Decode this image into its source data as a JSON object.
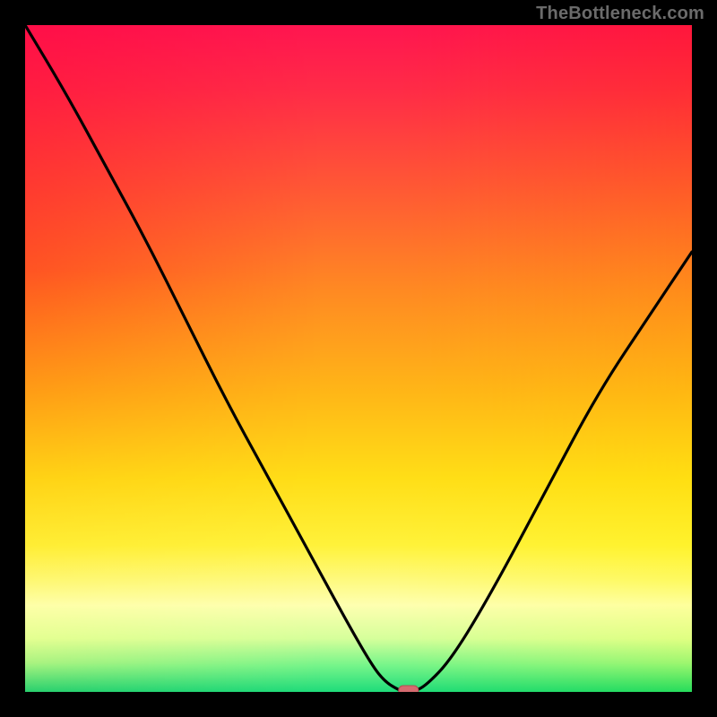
{
  "watermark": "TheBottleneck.com",
  "colors": {
    "background": "#000000",
    "curve": "#000000",
    "marker": "#d56a6f",
    "gradient_stops": [
      "#ff1550",
      "#ff5a34",
      "#ffb617",
      "#fff23a",
      "#1edc7a"
    ]
  },
  "chart_data": {
    "type": "line",
    "title": "",
    "xlabel": "",
    "ylabel": "",
    "xlim": [
      0,
      100
    ],
    "ylim": [
      0,
      100
    ],
    "grid": false,
    "legend": false,
    "series": [
      {
        "name": "bottleneck-curve",
        "x": [
          0,
          6,
          12,
          18,
          24,
          30,
          36,
          42,
          48,
          52,
          54,
          56,
          57,
          58,
          60,
          64,
          70,
          78,
          86,
          94,
          100
        ],
        "y": [
          100,
          90,
          79,
          68,
          56,
          44,
          33,
          22,
          11,
          4,
          1.5,
          0.3,
          0,
          0,
          0.8,
          5,
          15,
          30,
          45,
          57,
          66
        ]
      }
    ],
    "annotations": [
      {
        "name": "minimum-marker",
        "x": 57.5,
        "y": 0,
        "shape": "rounded-rect"
      }
    ],
    "minimum": {
      "x": 57.5,
      "y": 0
    }
  }
}
